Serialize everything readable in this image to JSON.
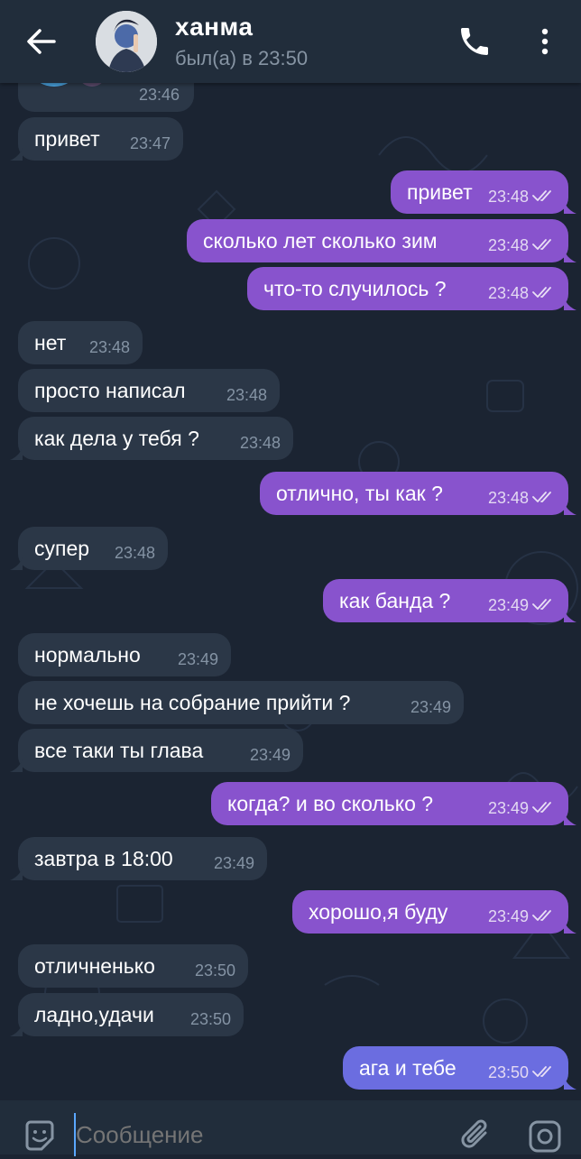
{
  "header": {
    "name": "ханма",
    "last_seen": "был(а) в 23:50"
  },
  "input": {
    "placeholder": "Сообщение"
  },
  "messages": [
    {
      "dir": "in",
      "text": "привет",
      "time": "23:47"
    },
    {
      "dir": "out",
      "text": "привет",
      "time": "23:48"
    },
    {
      "dir": "out",
      "text": "сколько лет сколько зим",
      "time": "23:48"
    },
    {
      "dir": "out",
      "text": "что-то случилось ?",
      "time": "23:48"
    },
    {
      "dir": "in",
      "text": "нет",
      "time": "23:48"
    },
    {
      "dir": "in",
      "text": "просто написал",
      "time": "23:48"
    },
    {
      "dir": "in",
      "text": "как дела у тебя ?",
      "time": "23:48"
    },
    {
      "dir": "out",
      "text": "отлично, ты как ?",
      "time": "23:48"
    },
    {
      "dir": "in",
      "text": "супер",
      "time": "23:48"
    },
    {
      "dir": "out",
      "text": "как банда ?",
      "time": "23:49"
    },
    {
      "dir": "in",
      "text": "нормально",
      "time": "23:49"
    },
    {
      "dir": "in",
      "text": "не хочешь на собрание прийти ?",
      "time": "23:49"
    },
    {
      "dir": "in",
      "text": "все таки ты глава",
      "time": "23:49"
    },
    {
      "dir": "out",
      "text": "когда? и во сколько ?",
      "time": "23:49"
    },
    {
      "dir": "in",
      "text": "завтра в 18:00",
      "time": "23:49"
    },
    {
      "dir": "out",
      "text": "хорошо,я буду",
      "time": "23:49"
    },
    {
      "dir": "in",
      "text": "отличненько",
      "time": "23:50"
    },
    {
      "dir": "in",
      "text": "ладно,удачи",
      "time": "23:50"
    },
    {
      "dir": "out",
      "text": "ага и тебе",
      "time": "23:50"
    }
  ],
  "sticker_message": {
    "time": "23:46"
  },
  "colors": {
    "background": "#1b2432",
    "header": "#212d3b",
    "incoming_bubble": "#2b3747",
    "outgoing_bubble": "#8853cd",
    "outgoing_bubble_last": "#6b6de0"
  }
}
